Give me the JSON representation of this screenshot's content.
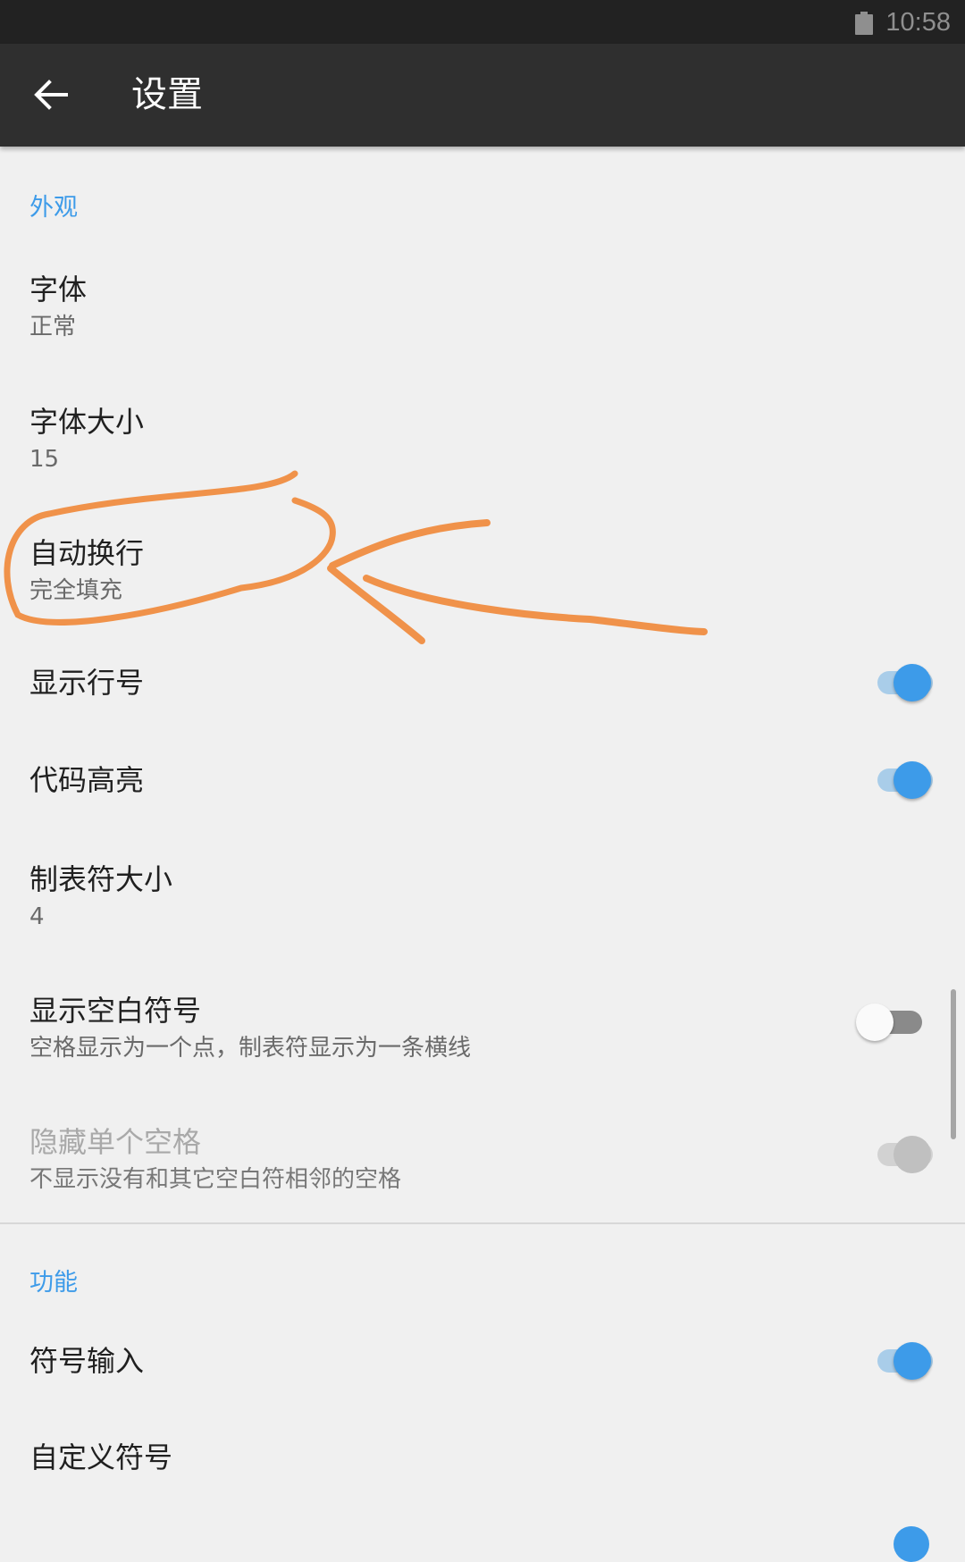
{
  "status_bar": {
    "time": "10:58",
    "icons": [
      "battery-icon"
    ]
  },
  "app_bar": {
    "title": "设置",
    "back_icon": "arrow-back-icon"
  },
  "sections": {
    "appearance": {
      "header": "外观",
      "font": {
        "title": "字体",
        "summary": "正常"
      },
      "font_size": {
        "title": "字体大小",
        "summary": "15"
      },
      "word_wrap": {
        "title": "自动换行",
        "summary": "完全填充"
      },
      "line_numbers": {
        "title": "显示行号",
        "switch": "on"
      },
      "syntax_highlight": {
        "title": "代码高亮",
        "switch": "on"
      },
      "tab_size": {
        "title": "制表符大小",
        "summary": "4"
      },
      "show_whitespace": {
        "title": "显示空白符号",
        "summary": "空格显示为一个点，制表符显示为一条横线",
        "switch": "off"
      },
      "hide_single_space": {
        "title": "隐藏单个空格",
        "summary": "不显示没有和其它空白符相邻的空格",
        "switch": "on",
        "enabled": false
      }
    },
    "features": {
      "header": "功能",
      "symbol_input": {
        "title": "符号输入",
        "switch": "on"
      },
      "custom_symbols": {
        "title": "自定义符号"
      }
    }
  },
  "colors": {
    "accent": "#3d9be9",
    "app_bar": "#2f2f2f",
    "status_bar": "#222222",
    "background": "#f0f0f0",
    "annotation": "#f0924a"
  },
  "annotation": {
    "type": "hand-drawn-circle-and-arrow",
    "target": "word_wrap"
  }
}
